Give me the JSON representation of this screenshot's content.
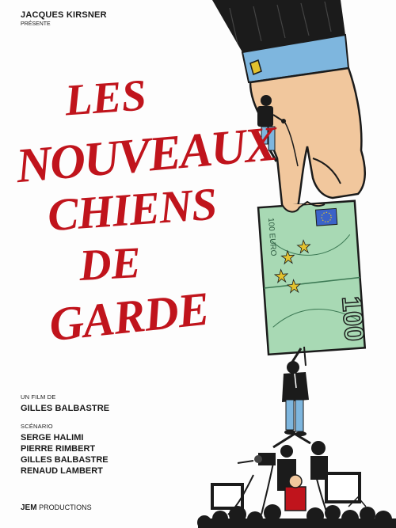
{
  "presenter": {
    "name": "JACQUES KIRSNER",
    "verb": "PRÉSENTE"
  },
  "title": {
    "line1": "LES",
    "line2": "NOUVEAUX",
    "line3": "CHIENS",
    "line4": "DE",
    "line5": "GARDE"
  },
  "credits": {
    "film_by_label": "UN FILM DE",
    "director": "GILLES BALBASTRE",
    "screenplay_label": "SCÉNARIO",
    "writers": [
      "SERGE HALIMI",
      "PIERRE RIMBERT",
      "GILLES BALBASTRE",
      "RENAUD LAMBERT"
    ]
  },
  "producer": {
    "brand": "JEM",
    "suffix": " PRODUCTIONS"
  },
  "banknote": {
    "denomination": "100",
    "corner_text": "100 EURO"
  },
  "colors": {
    "title_red": "#c0141c",
    "banknote_green": "#a8d9b4",
    "suit_black": "#1b1b1b",
    "shirt_blue": "#7eb6de"
  }
}
